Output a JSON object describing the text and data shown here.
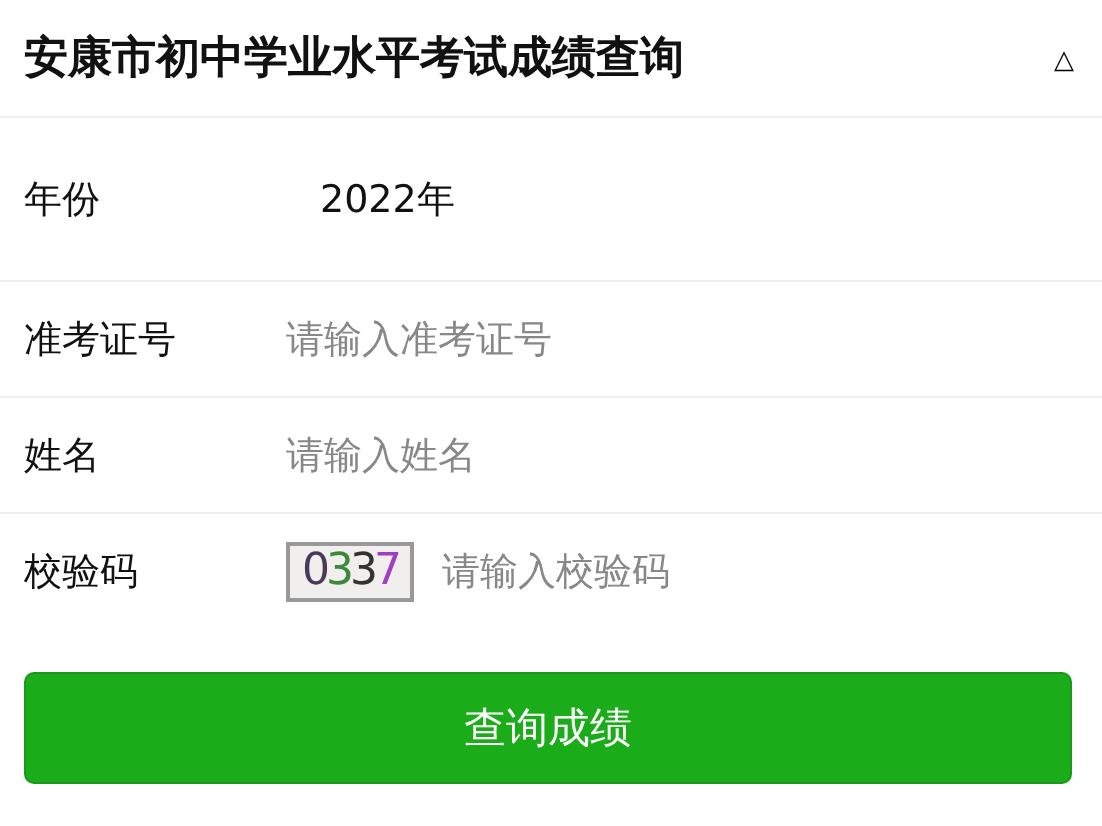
{
  "header": {
    "title": "安康市初中学业水平考试成绩查询",
    "toggle": "△"
  },
  "fields": [
    {
      "kind": "value",
      "label": "年份",
      "value": "2022年"
    },
    {
      "kind": "input",
      "label": "准考证号",
      "placeholder": "请输入准考证号"
    },
    {
      "kind": "input",
      "label": "姓名",
      "placeholder": "请输入姓名"
    },
    {
      "kind": "captcha",
      "label": "校验码",
      "captcha": "0337",
      "placeholder": "请输入校验码"
    }
  ],
  "submit": "查询成绩"
}
